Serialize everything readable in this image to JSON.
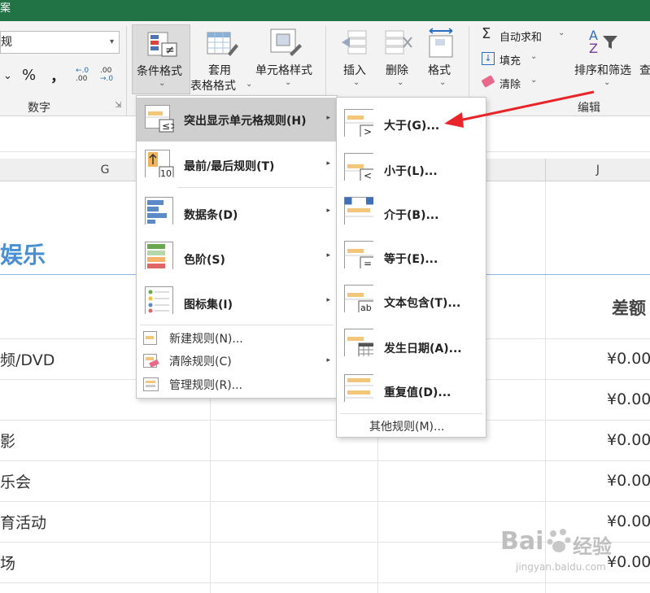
{
  "title": {
    "text": "案"
  },
  "colors": {
    "excel_green": "#217346",
    "accent_blue": "#4a8fd2",
    "arrow_red": "#e8262a",
    "highlight": "#cfcfcf"
  },
  "ribbon": {
    "number_format_value": "规",
    "number_buttons": {
      "percent": "%",
      "comma": "，",
      "inc_dec_1": "←.0",
      "inc_dec_2": ".00",
      "dec_dec_1": ".00",
      "dec_dec_2": "→.0"
    },
    "number_group_label": "数字",
    "conditional_format": {
      "line1": "条件格式",
      "chevron": "⌄"
    },
    "table_format": {
      "line1": "套用",
      "line2": "表格格式",
      "chevron": "⌄"
    },
    "cell_style": {
      "line1": "单元格样式",
      "chevron": "⌄"
    },
    "insert": {
      "label": "插入",
      "chevron": "⌄"
    },
    "delete": {
      "label": "删除",
      "chevron": "⌄"
    },
    "format": {
      "label": "格式",
      "chevron": "⌄"
    },
    "autosum": {
      "symbol": "Σ",
      "label": "自动求和",
      "chevron": "⌄"
    },
    "fill": {
      "label": "填充",
      "chevron": "⌄"
    },
    "clear": {
      "label": "清除",
      "chevron": "⌄"
    },
    "sort_filter": {
      "label": "排序和筛选",
      "chevron": "⌄",
      "az": "A",
      "za": "Z"
    },
    "find_partial": "查",
    "edit_group_label": "编辑"
  },
  "sheet": {
    "col_g": "G",
    "col_j": "J",
    "heading": "娱乐",
    "diff_header": "差额",
    "rows": [
      {
        "label": "频/DVD",
        "value": "¥0.00"
      },
      {
        "label": "",
        "value": "¥0.00"
      },
      {
        "label": "影",
        "value": "¥0.00"
      },
      {
        "label": "乐会",
        "value": "¥0.00"
      },
      {
        "label": "育活动",
        "value": "¥0.00"
      },
      {
        "label": "场",
        "value": "¥0.00"
      }
    ]
  },
  "menu_main": {
    "items": [
      {
        "label": "突出显示单元格规则(H)",
        "icon": "highlight-rules-icon"
      },
      {
        "label": "最前/最后规则(T)",
        "icon": "top-bottom-icon"
      },
      {
        "label": "数据条(D)",
        "icon": "data-bars-icon"
      },
      {
        "label": "色阶(S)",
        "icon": "color-scales-icon"
      },
      {
        "label": "图标集(I)",
        "icon": "icon-sets-icon"
      }
    ],
    "small_items": [
      {
        "label": "新建规则(N)...",
        "icon": "new-rule-icon"
      },
      {
        "label": "清除规则(C)",
        "icon": "clear-rules-icon"
      },
      {
        "label": "管理规则(R)...",
        "icon": "manage-rules-icon"
      }
    ],
    "arrow": "▸"
  },
  "menu_sub": {
    "items": [
      {
        "label": "大于(G)...",
        "icon": "greater-than-icon",
        "symbol": ">"
      },
      {
        "label": "小于(L)...",
        "icon": "less-than-icon",
        "symbol": "<"
      },
      {
        "label": "介于(B)...",
        "icon": "between-icon",
        "symbol": ""
      },
      {
        "label": "等于(E)...",
        "icon": "equal-to-icon",
        "symbol": "="
      },
      {
        "label": "文本包含(T)...",
        "icon": "text-contains-icon",
        "symbol": "ab"
      },
      {
        "label": "发生日期(A)...",
        "icon": "date-occurring-icon",
        "symbol": ""
      },
      {
        "label": "重复值(D)...",
        "icon": "duplicate-values-icon",
        "symbol": ""
      }
    ],
    "more_rules": "其他规则(M)..."
  },
  "watermark": {
    "brand": "Bai",
    "brand2": "经验",
    "url": "jingyan.baidu.com"
  }
}
